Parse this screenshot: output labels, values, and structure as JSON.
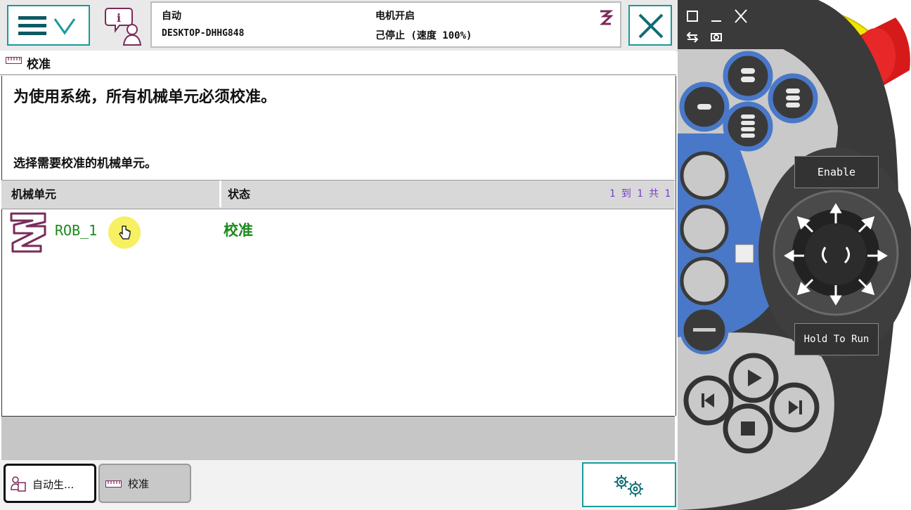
{
  "header": {
    "mode": "自动",
    "computer": "DESKTOP-DHHG848",
    "motor": "电机开启",
    "state": "己停止 (速度 100%)"
  },
  "title": "校准",
  "intro": "为使用系统，所有机械单元必须校准。",
  "prompt": "选择需要校准的机械单元。",
  "table": {
    "headers": [
      "机械单元",
      "状态"
    ],
    "pagination": "1 到 1 共 1",
    "rows": [
      {
        "unit": "ROB_1",
        "status": "校准"
      }
    ]
  },
  "taskbar": {
    "tasks": [
      {
        "label": "自动生..."
      },
      {
        "label": "校准"
      }
    ]
  },
  "pendant": {
    "enable_label": "Enable",
    "hold_label": "Hold To Run"
  },
  "icons": [
    "menu-icon",
    "chevron-down-icon",
    "info-user-icon",
    "robot-icon",
    "close-icon",
    "ruler-icon",
    "cursor-hand-icon",
    "gear-icon"
  ],
  "colors": {
    "teal": "#1a9a9a",
    "green": "#1b8a1b",
    "purple": "#7b2b5a",
    "pendant_blue": "#4a78c8",
    "emergency_red": "#d61a1a",
    "yellow": "#f2e600"
  }
}
